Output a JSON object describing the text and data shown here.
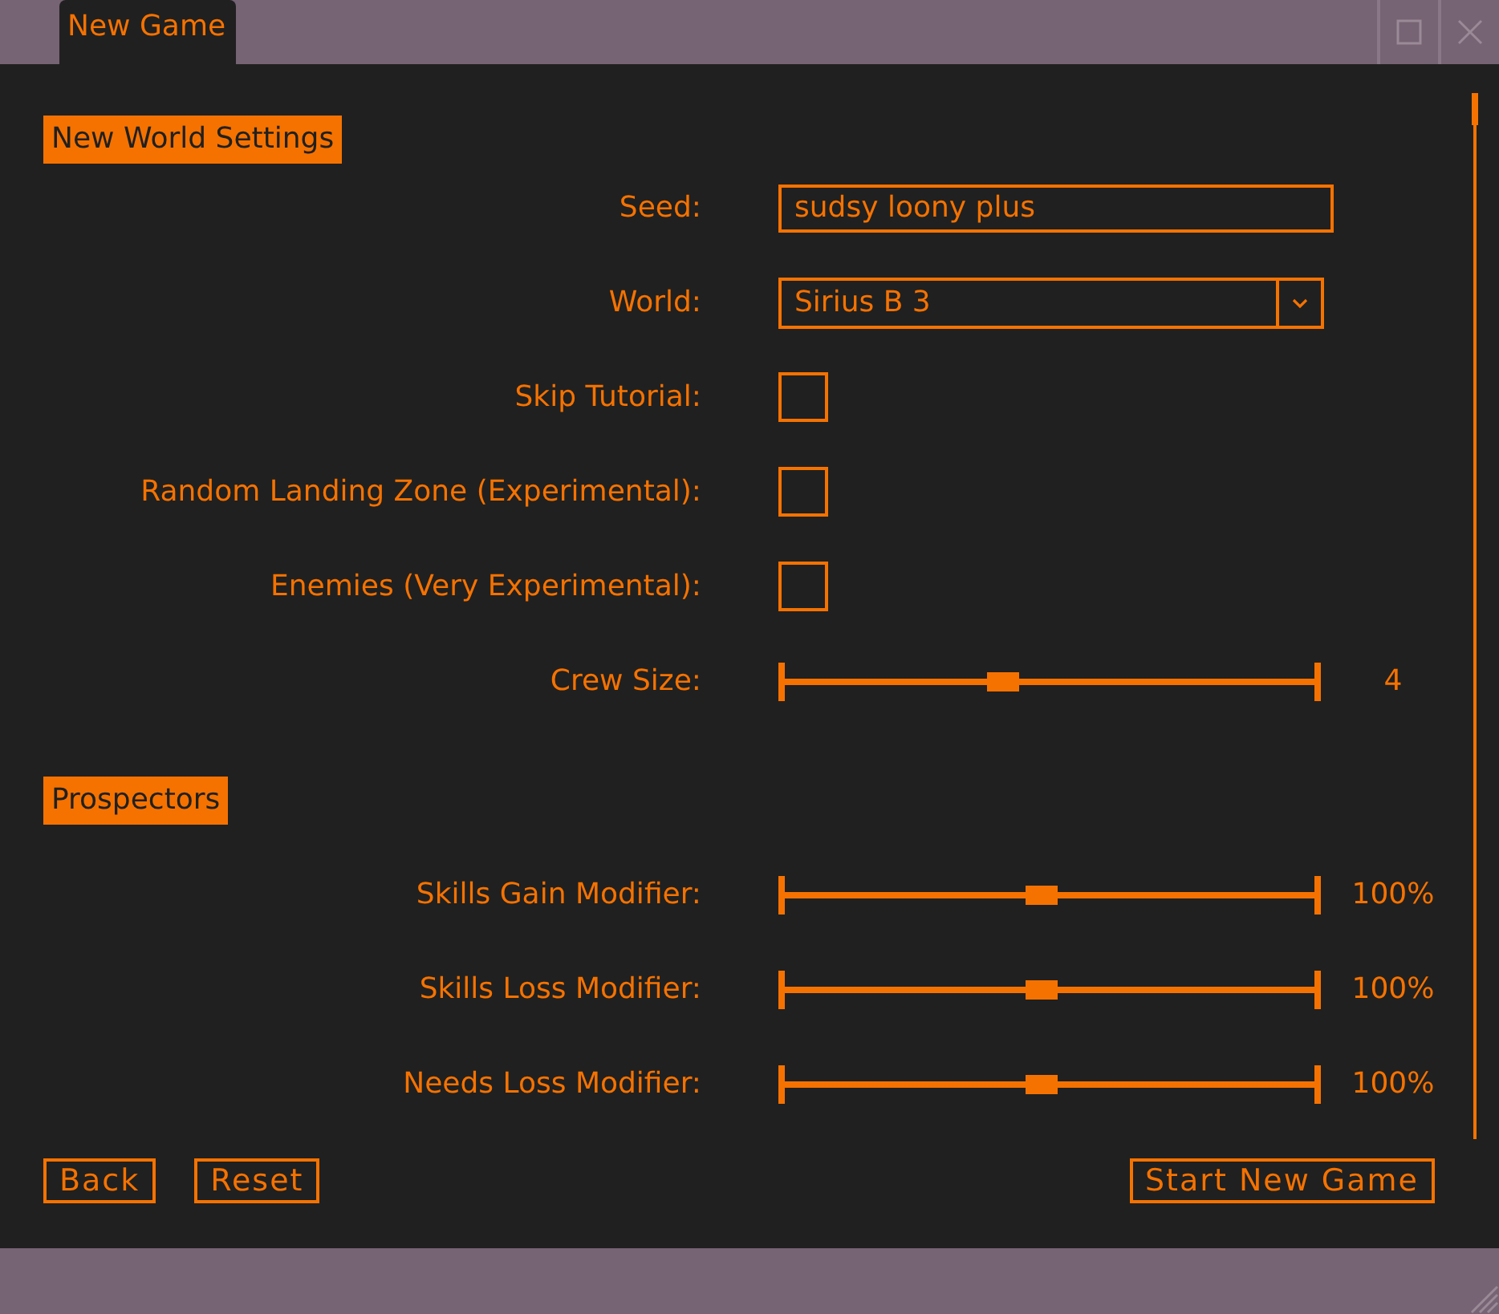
{
  "window": {
    "tab": "New Game"
  },
  "sections": [
    {
      "title": "New World Settings",
      "settings": [
        {
          "kind": "text",
          "label": "Seed:",
          "value": "sudsy loony plus"
        },
        {
          "kind": "dropdown",
          "label": "World:",
          "value": "Sirius B 3"
        },
        {
          "kind": "checkbox",
          "label": "Skip Tutorial:",
          "checked": false
        },
        {
          "kind": "checkbox",
          "label": "Random Landing Zone (Experimental):",
          "checked": false
        },
        {
          "kind": "checkbox",
          "label": "Enemies (Very Experimental):",
          "checked": false
        },
        {
          "kind": "slider",
          "label": "Crew Size:",
          "level": 0.43,
          "reading": "4"
        }
      ]
    },
    {
      "title": "Prospectors",
      "settings": [
        {
          "kind": "slider",
          "label": "Skills Gain Modifier:",
          "level": 0.5,
          "reading": "100%"
        },
        {
          "kind": "slider",
          "label": "Skills Loss Modifier:",
          "level": 0.5,
          "reading": "100%"
        },
        {
          "kind": "slider",
          "label": "Needs Loss Modifier:",
          "level": 0.5,
          "reading": "100%"
        }
      ]
    }
  ],
  "buttons_left": [
    "Back",
    "Reset"
  ],
  "buttons_right": [
    "Start New Game"
  ]
}
